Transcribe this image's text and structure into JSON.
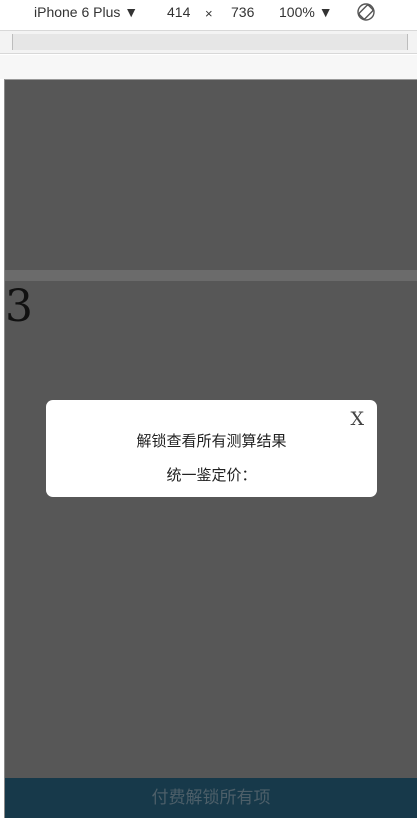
{
  "devtools": {
    "device": "iPhone 6 Plus ▼",
    "width": "414",
    "times": "×",
    "height": "736",
    "zoom": "100% ▼"
  },
  "page": {
    "counter": "3",
    "modal": {
      "close": "X",
      "title": "解锁查看所有测算结果",
      "price_label": "统一鉴定价："
    },
    "pay_button": "付费解锁所有项"
  },
  "colors": {
    "overlay": "#575757",
    "pay_bar": "#17394a"
  },
  "icons": [
    "rotate-icon"
  ]
}
